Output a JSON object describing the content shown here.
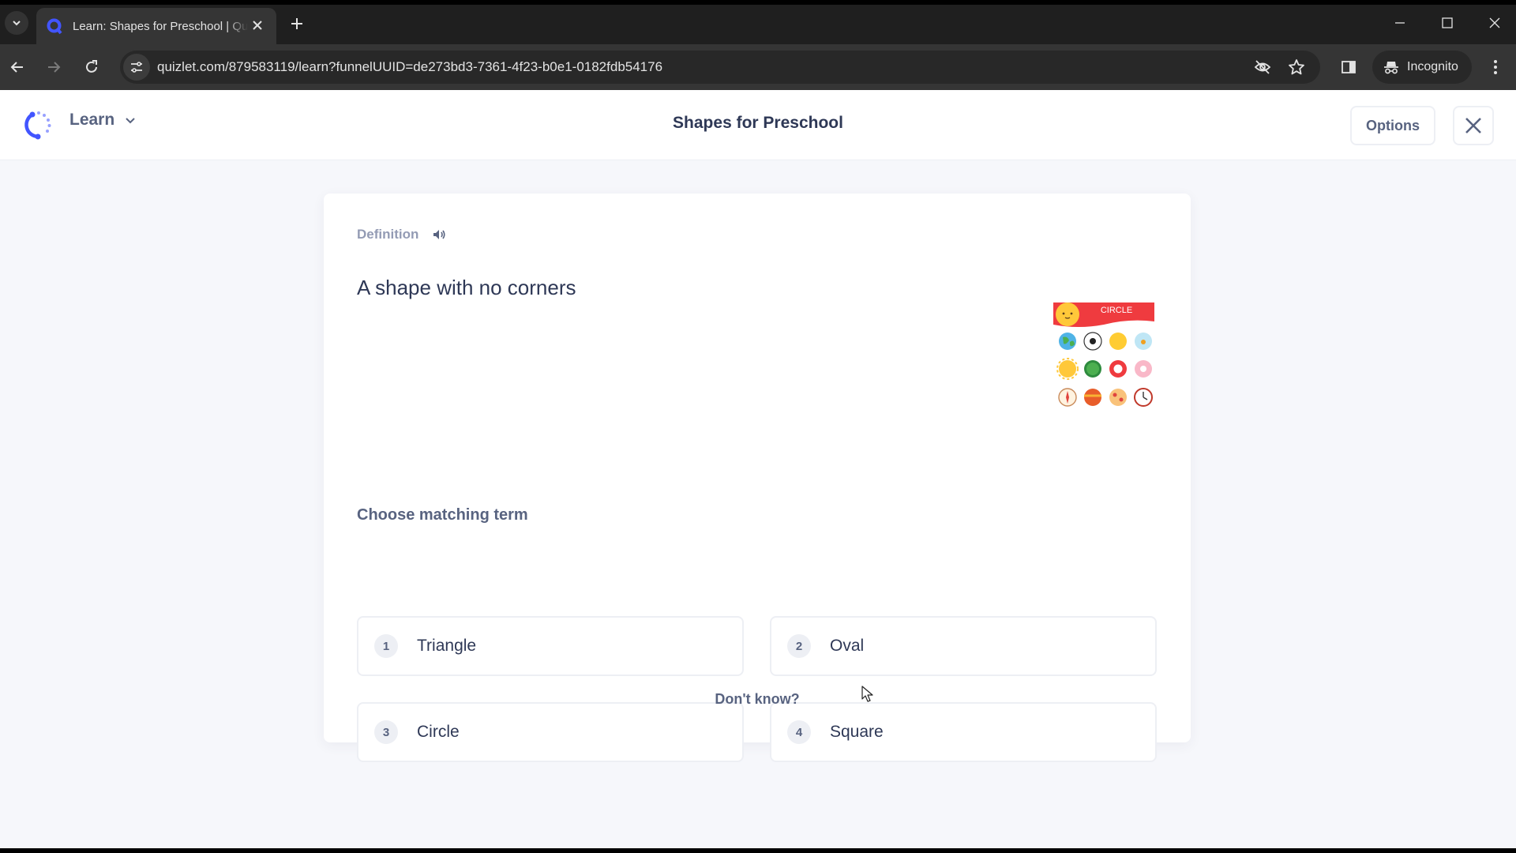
{
  "browser": {
    "tab": {
      "title": "Learn: Shapes for Preschool | Quizlet",
      "favicon": "quizlet-q-icon"
    },
    "url": "quizlet.com/879583119/learn?funnelUUID=de273bd3-7361-4f23-b0e1-0182fdb54176",
    "incognito_label": "Incognito",
    "icons": {
      "tab_search": "chevron-down-icon",
      "tab_close": "close-icon",
      "new_tab": "plus-icon",
      "back": "arrow-left-icon",
      "forward": "arrow-right-icon",
      "reload": "reload-icon",
      "site_info": "tune-icon",
      "tracking": "eye-off-icon",
      "bookmark": "star-icon",
      "side_panel": "side-panel-icon",
      "incognito": "incognito-icon",
      "menu": "more-vert-icon",
      "minimize": "minimize-icon",
      "maximize": "maximize-icon",
      "close": "close-icon"
    }
  },
  "header": {
    "mode_label": "Learn",
    "set_title": "Shapes for Preschool",
    "options_label": "Options",
    "brand_color": "#4255ff"
  },
  "question": {
    "prompt_type": "Definition",
    "definition": "A shape with no corners",
    "image": {
      "banner_text": "CIRCLE",
      "alt": "Circle-shaped objects: sun, globe, soccer ball, orange slice, fishbowl, watermelon, life ring, donut, compass, ball, pizza, clock"
    },
    "choose_label": "Choose matching term",
    "options": [
      {
        "number": "1",
        "term": "Triangle"
      },
      {
        "number": "2",
        "term": "Oval"
      },
      {
        "number": "3",
        "term": "Circle"
      },
      {
        "number": "4",
        "term": "Square"
      }
    ],
    "dont_know_label": "Don't know?"
  }
}
